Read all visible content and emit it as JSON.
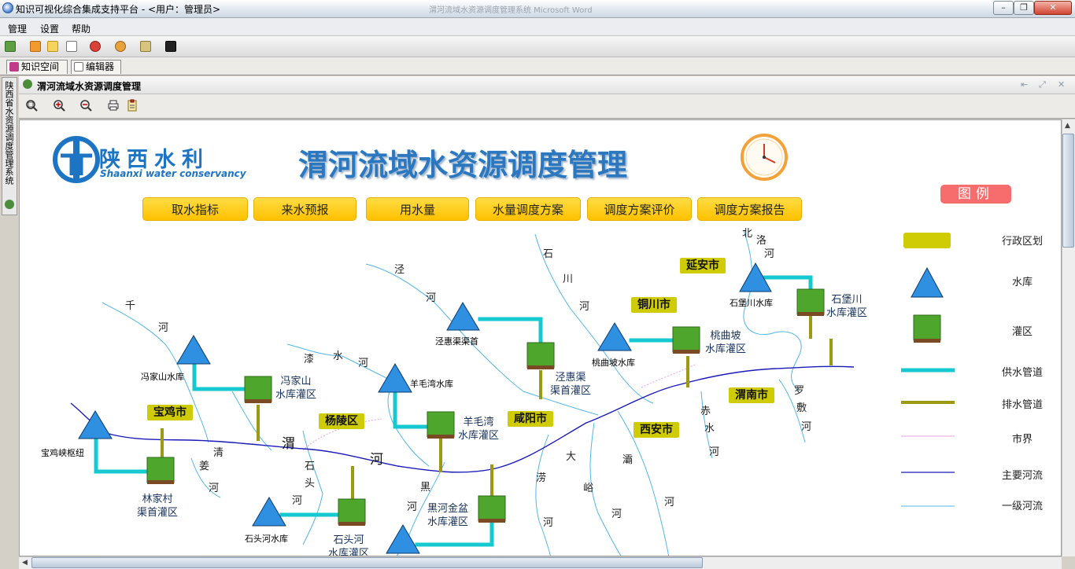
{
  "window": {
    "title": "知识可视化综合集成支持平台 - <用户：管理员>",
    "bg_title": "渭河流域水资源调度管理系统    Microsoft Word"
  },
  "menu": [
    "管理",
    "设置",
    "帮助"
  ],
  "tabs": [
    {
      "label": "知识空间"
    },
    {
      "label": "编辑器"
    }
  ],
  "side_tab": {
    "label": "陕西省水资源调度管理系统"
  },
  "panel": {
    "title": "渭河流域水资源调度管理"
  },
  "canvas": {
    "logo_text": "陕西水利",
    "logo_sub": "Shaanxi water conservancy",
    "main_title": "渭河流域水资源调度管理",
    "nav": [
      "取水指标",
      "来水预报",
      "用水量",
      "水量调度方案",
      "调度方案评价",
      "调度方案报告"
    ],
    "legend": {
      "title": "图例",
      "items": [
        "行政区划",
        "水库",
        "灌区",
        "供水管道",
        "排水管道",
        "市界",
        "主要河流",
        "一级河流"
      ]
    },
    "regions": [
      "延安市",
      "铜川市",
      "宝鸡市",
      "杨陵区",
      "咸阳市",
      "西安市",
      "渭南市"
    ],
    "reservoirs": [
      "石堡川水库",
      "桃曲坡水库",
      "泾惠渠渠首",
      "冯家山水库",
      "羊毛湾水库",
      "宝鸡峡枢纽",
      "石头河水库"
    ],
    "irrigation": {
      "shibaochuan": [
        "石堡川",
        "水库灌区"
      ],
      "taoqupo": [
        "桃曲坡",
        "水库灌区"
      ],
      "jinghuiqu": [
        "泾惠渠",
        "渠首灌区"
      ],
      "fengjiashan": [
        "冯家山",
        "水库灌区"
      ],
      "yangmaowan": [
        "羊毛湾",
        "水库灌区"
      ],
      "linjiacun": [
        "林家村",
        "渠首灌区"
      ],
      "shitouhe": [
        "石头河",
        "水库灌区"
      ],
      "heihe": [
        "黑河金盆",
        "水库灌区"
      ]
    },
    "rivers": {
      "beiluo": [
        "北",
        "洛",
        "河"
      ],
      "shichuan": [
        "石",
        "川",
        "河"
      ],
      "jing": [
        "泾",
        "河"
      ],
      "qian": [
        "千",
        "河"
      ],
      "qishui": [
        "漆",
        "水",
        "河"
      ],
      "luo": [
        "罗",
        "敷",
        "河"
      ],
      "chishui": [
        "赤",
        "水",
        "河"
      ],
      "wei": [
        "渭",
        "河"
      ],
      "qingjiang": [
        "清",
        "姜",
        "河"
      ],
      "shitou": [
        "石",
        "头",
        "河"
      ],
      "hei": [
        "黑",
        "河"
      ],
      "lao": [
        "涝",
        "河"
      ],
      "dayu": [
        "大",
        "峪",
        "河"
      ],
      "ba": [
        "灞",
        "河"
      ]
    }
  },
  "colors": {
    "region": "#cfcc06",
    "supply_pipe": "#16c8d0",
    "drain_pipe": "#9c9a12",
    "main_river": "#1a1ab8",
    "tributary": "#52b6e6",
    "city_boundary": "#e6a0e6",
    "nav_button": "#ffc600"
  }
}
